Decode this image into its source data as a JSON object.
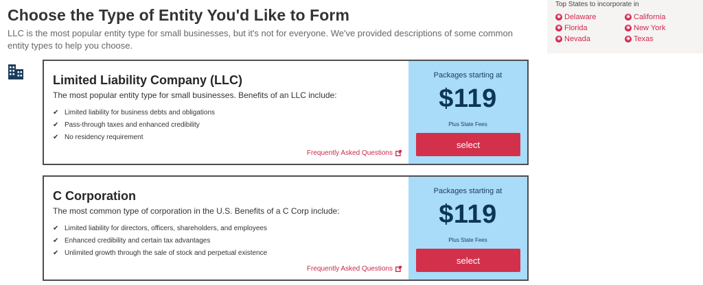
{
  "header": {
    "title": "Choose the Type of Entity You'd Like to Form",
    "intro": "LLC is the most popular entity type for small businesses, but it's not for everyone. We've provided descriptions of some common entity types to help you choose."
  },
  "top_states": {
    "title": "Top States to incorporate in",
    "states": [
      "Delaware",
      "California",
      "Florida",
      "New York",
      "Nevada",
      "Texas"
    ]
  },
  "cards": [
    {
      "title": "Limited Liability Company (LLC)",
      "description": "The most popular entity type for small businesses. Benefits of an LLC include:",
      "benefits": [
        "Limited liability for business debts and obligations",
        "Pass-through taxes and enhanced credibility",
        "No residency requirement"
      ],
      "faq_label": "Frequently Asked Questions",
      "price_label": "Packages starting at",
      "price": "$119",
      "fees_note": "Plus State Fees",
      "select_label": "select"
    },
    {
      "title": "C Corporation",
      "description": "The most common type of corporation in the U.S. Benefits of a C Corp include:",
      "benefits": [
        "Limited liability for directors, officers, shareholders, and employees",
        "Enhanced credibility and certain tax advantages",
        "Unlimited growth through the sale of stock and perpetual existence"
      ],
      "faq_label": "Frequently Asked Questions",
      "price_label": "Packages starting at",
      "price": "$119",
      "fees_note": "Plus State Fees",
      "select_label": "select"
    }
  ],
  "colors": {
    "accent": "#d0274f",
    "price_panel": "#a8dcf8",
    "price_text": "#0c3557",
    "button": "#d3304c"
  },
  "icons": {
    "entity": "building-icon",
    "check": "check-icon",
    "external": "external-link-icon",
    "state_pin": "map-pin-icon"
  }
}
